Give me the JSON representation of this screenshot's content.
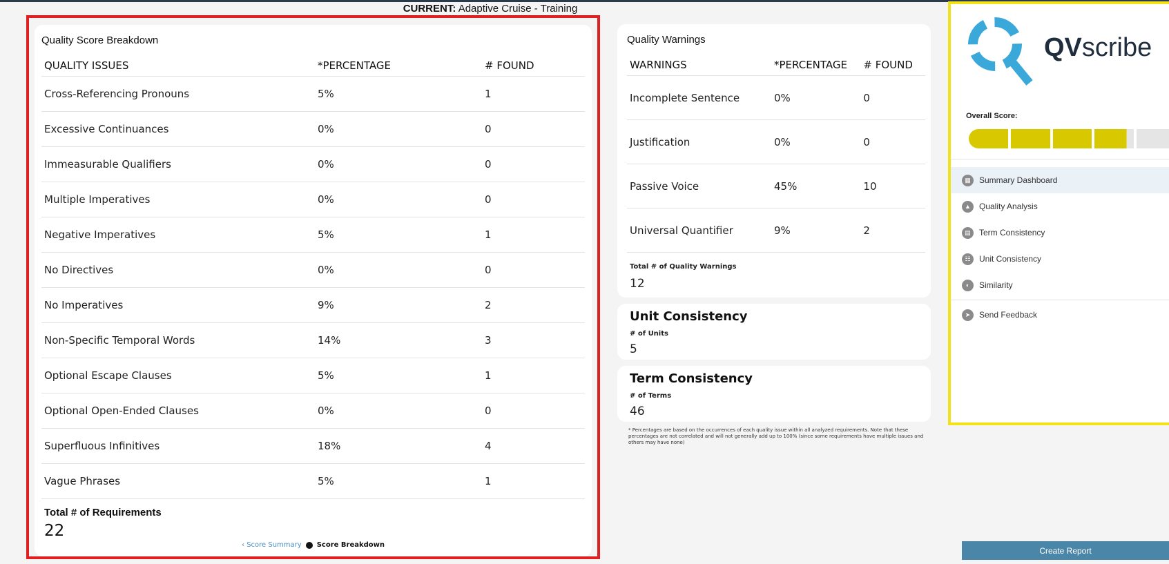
{
  "header": {
    "current_label": "CURRENT:",
    "current_name": "Adaptive Cruise - Training"
  },
  "quality_breakdown": {
    "title": "Quality Score Breakdown",
    "columns": [
      "QUALITY ISSUES",
      "*PERCENTAGE",
      "# FOUND"
    ],
    "rows": [
      [
        "Cross-Referencing Pronouns",
        "5%",
        "1"
      ],
      [
        "Excessive Continuances",
        "0%",
        "0"
      ],
      [
        "Immeasurable Qualifiers",
        "0%",
        "0"
      ],
      [
        "Multiple Imperatives",
        "0%",
        "0"
      ],
      [
        "Negative Imperatives",
        "5%",
        "1"
      ],
      [
        "No Directives",
        "0%",
        "0"
      ],
      [
        "No Imperatives",
        "9%",
        "2"
      ],
      [
        "Non-Specific Temporal Words",
        "14%",
        "3"
      ],
      [
        "Optional Escape Clauses",
        "5%",
        "1"
      ],
      [
        "Optional Open-Ended Clauses",
        "0%",
        "0"
      ],
      [
        "Superfluous Infinitives",
        "18%",
        "4"
      ],
      [
        "Vague Phrases",
        "5%",
        "1"
      ]
    ],
    "total_label": "Total # of Requirements",
    "total_value": "22",
    "pager": {
      "prev": "Score Summary",
      "current": "Score Breakdown"
    }
  },
  "quality_warnings": {
    "title": "Quality Warnings",
    "columns": [
      "WARNINGS",
      "*PERCENTAGE",
      "# FOUND"
    ],
    "rows": [
      [
        "Incomplete Sentence",
        "0%",
        "0"
      ],
      [
        "Justification",
        "0%",
        "0"
      ],
      [
        "Passive Voice",
        "45%",
        "10"
      ],
      [
        "Universal Quantifier",
        "9%",
        "2"
      ]
    ],
    "total_label": "Total # of Quality Warnings",
    "total_value": "12"
  },
  "unit_consistency": {
    "title": "Unit Consistency",
    "label": "# of Units",
    "value": "5"
  },
  "term_consistency": {
    "title": "Term Consistency",
    "label": "# of Terms",
    "value": "46"
  },
  "footnote": "* Percentages are based on the occurrences of each quality issue within all analyzed requirements. Note that these percentages are not correlated and will not generally add up to 100% (since some requirements have multiple issues and others may have none)",
  "sidebar": {
    "logo_bold": "QV",
    "logo_rest": "scribe",
    "overall_score_label": "Overall Score:",
    "score_fraction": 0.77,
    "colors": {
      "filled": "#d8c800",
      "empty": "#e5e5e5",
      "accent": "#3aa8d8"
    },
    "nav": [
      {
        "label": "Summary Dashboard",
        "icon": "dashboard-icon",
        "active": true
      },
      {
        "label": "Quality Analysis",
        "icon": "warning-icon"
      },
      {
        "label": "Term Consistency",
        "icon": "document-icon"
      },
      {
        "label": "Unit Consistency",
        "icon": "ruler-icon"
      },
      {
        "label": "Similarity",
        "icon": "similarity-icon"
      },
      {
        "label": "Send Feedback",
        "icon": "send-icon"
      }
    ],
    "create_report_label": "Create Report"
  }
}
